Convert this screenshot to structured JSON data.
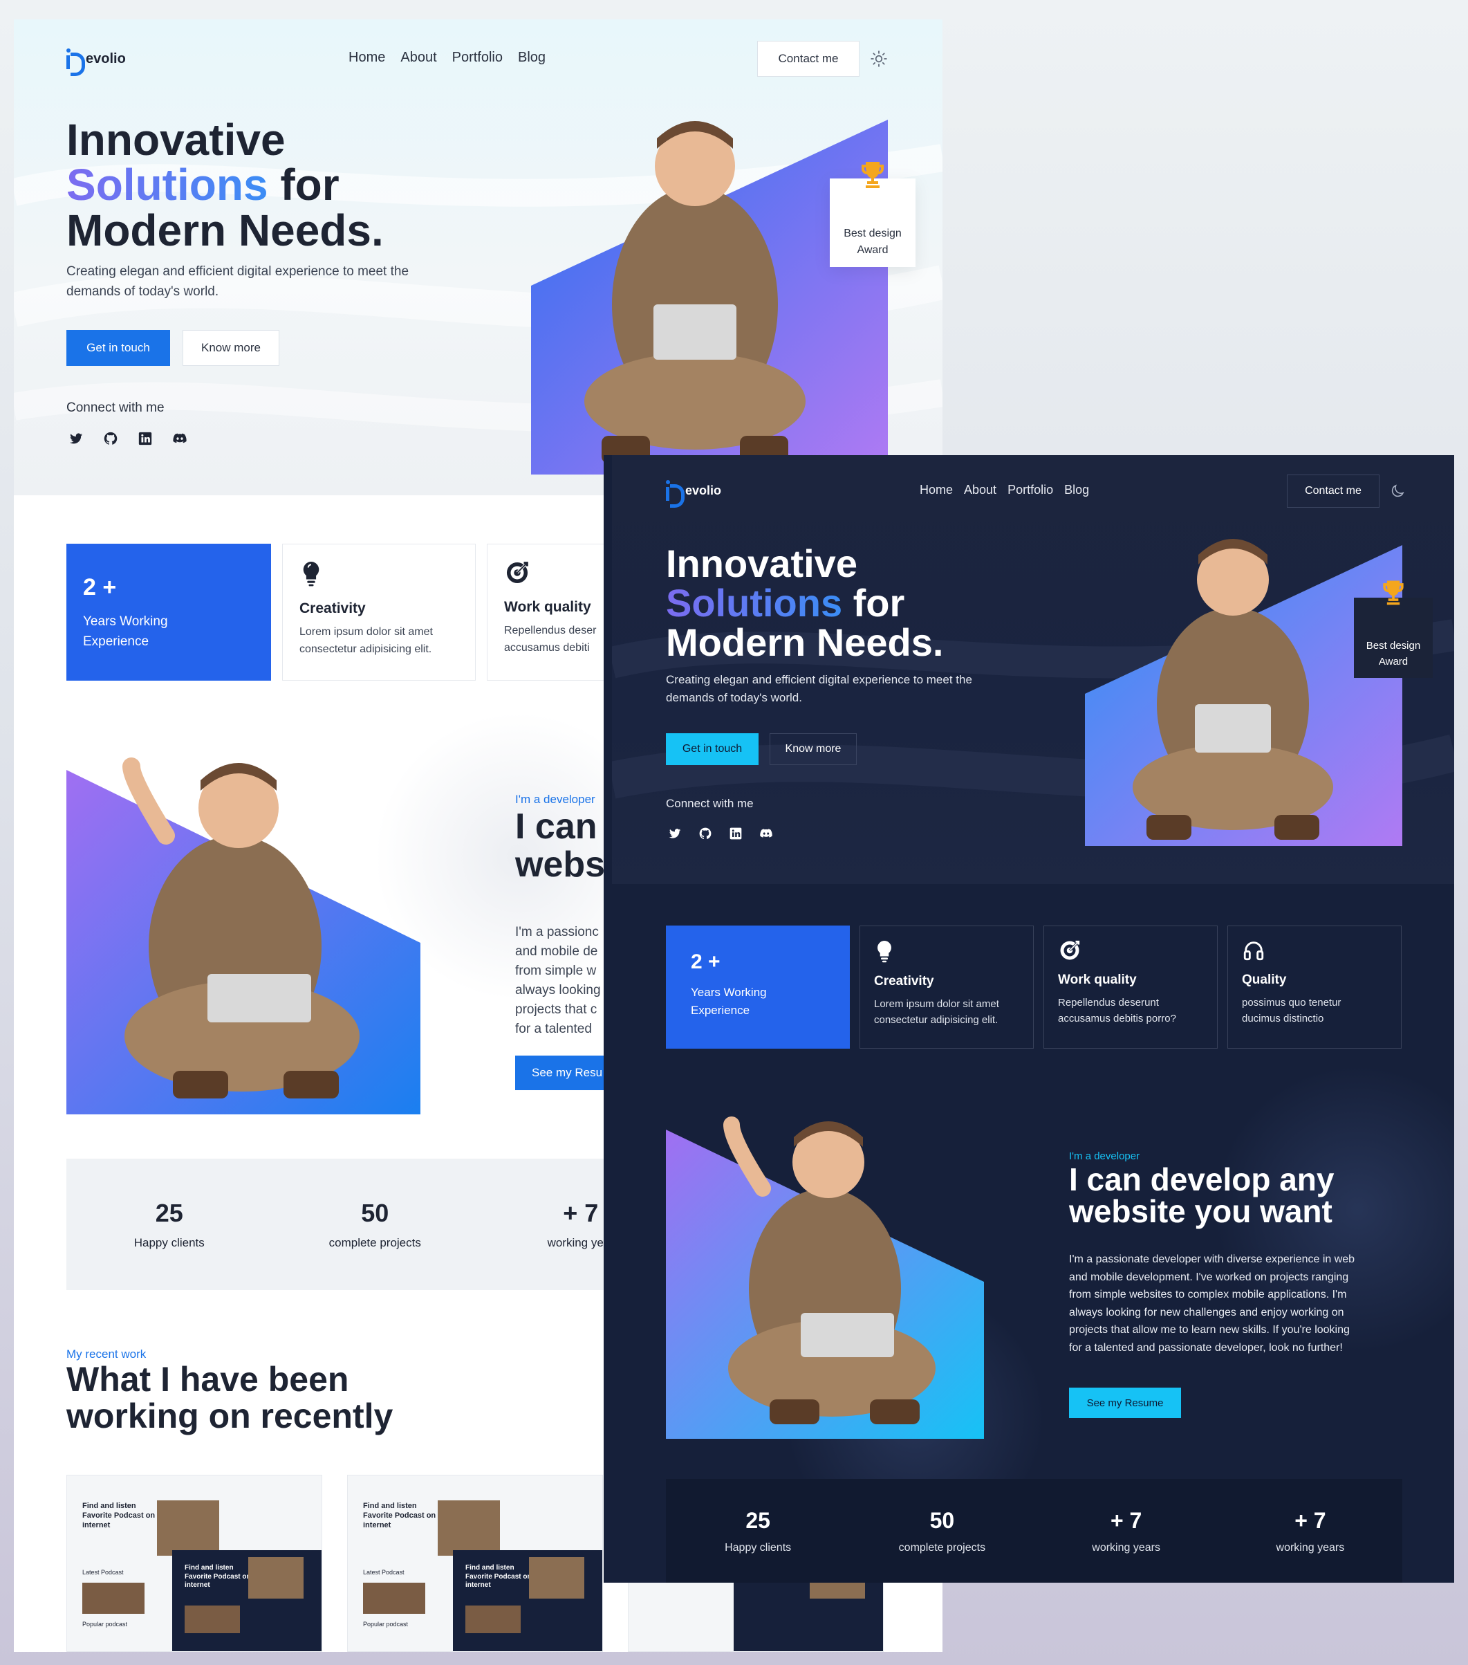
{
  "brand": {
    "name": "evolio"
  },
  "nav": {
    "home": "Home",
    "about": "About",
    "portfolio": "Portfolio",
    "blog": "Blog"
  },
  "header": {
    "contact_label": "Contact me",
    "light_theme_icon": "sun-icon",
    "dark_theme_icon": "moon-icon"
  },
  "hero": {
    "title_line1": "Innovative",
    "title_highlight": "Solutions",
    "title_after_highlight": " for",
    "title_line3": "Modern Needs.",
    "description": "Creating elegan and efficient digital experience to meet the demands of today's world.",
    "primary_button": "Get in touch",
    "secondary_button": "Know more",
    "connect_label": "Connect with me",
    "award_line1": "Best design",
    "award_line2": "Award",
    "social_icons": [
      "twitter-icon",
      "github-icon",
      "linkedin-icon",
      "discord-icon"
    ]
  },
  "features": {
    "experience": {
      "number": "2 +",
      "label_line1": "Years Working",
      "label_line2": "Experience"
    },
    "creativity": {
      "title": "Creativity",
      "desc_line1": "Lorem ipsum dolor sit amet",
      "desc_line2": "consectetur adipisicing elit."
    },
    "work_quality": {
      "title": "Work quality",
      "desc_line1": "Repellendus deserunt",
      "desc_line2": "accusamus debitis porro?"
    },
    "quality": {
      "title": "Quality",
      "desc_line1": "possimus quo tenetur",
      "desc_line2": "ducimus distinctio"
    }
  },
  "about": {
    "eyebrow": "I'm a developer",
    "title_line1": "I can develop any",
    "title_line2": "website you want",
    "paragraph_lines": [
      "I'm a passionate developer with diverse experience in web",
      "and mobile development. I've worked on projects ranging",
      "from simple websites to complex mobile applications. I'm",
      "always looking for new challenges and enjoy working on",
      "projects that allow me to learn new skills. If you're looking",
      "for a talented and passionate developer, look no further!"
    ],
    "resume_button": "See my Resume"
  },
  "light_crops": {
    "about_title_line1": "I can",
    "about_title_line2": "webs",
    "about_para_lines": [
      "I'm a passionc",
      "and mobile de",
      "from simple w",
      "always looking",
      "projects that c",
      "for a talented"
    ],
    "resume_button": "See my Resu",
    "work_quality_desc_line1": "Repellendus deser",
    "work_quality_desc_line2": "accusamus debiti",
    "stat3_label": "working year"
  },
  "stats": [
    {
      "number": "25",
      "label": "Happy clients"
    },
    {
      "number": "50",
      "label": "complete projects"
    },
    {
      "number": "+ 7",
      "label": "working years"
    },
    {
      "number": "+ 7",
      "label": "working years"
    }
  ],
  "recent_work": {
    "eyebrow": "My recent work",
    "title_line1": "What I have been",
    "title_line2": "working on recently",
    "thumb_heading_lines": [
      "Find and listen",
      "Favorite Podcast on",
      "internet"
    ],
    "thumb_heading_highlight": "Podcast",
    "thumb_label_latest": "Latest Podcast",
    "thumb_label_popular": "Popular podcast",
    "thumb_crop_word": "internet"
  },
  "colors": {
    "primary_blue": "#1a73e8",
    "card_blue": "#2463eb",
    "dark_cta": "#16c2f5",
    "dark_bg": "#16203a",
    "heading_dark": "#1e2433",
    "gradient_start": "#7c6cf0",
    "gradient_end": "#3b8df5"
  }
}
